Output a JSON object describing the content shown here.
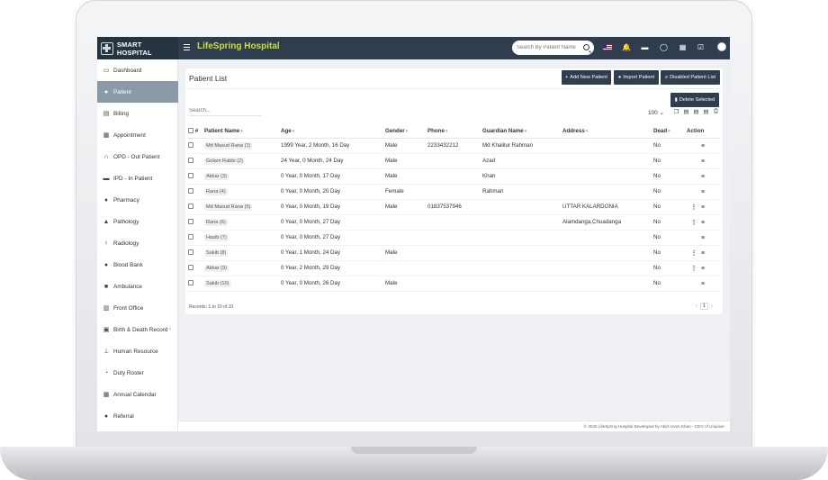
{
  "app": {
    "brand": "SMART HOSPITAL",
    "hospital_name": "LifeSpring Hospital",
    "search_placeholder": "Search By Patient Name"
  },
  "icons": {
    "flag": "us-flag-icon",
    "bell": "bell-icon",
    "bed": "bed-icon",
    "whatsapp": "whatsapp-icon",
    "calendar": "calendar-icon",
    "tasks": "checkbox-icon",
    "user": "user-avatar"
  },
  "colors": {
    "topbar": "#2f3d4e",
    "accent_text": "#c6e03c",
    "active_sidebar": "#8a9aa6"
  },
  "sidebar": {
    "items": [
      {
        "label": "Dashboard",
        "icon": "desktop-icon",
        "active": false
      },
      {
        "label": "Patient",
        "icon": "user-icon",
        "active": true
      },
      {
        "label": "Billing",
        "icon": "file-icon",
        "active": false
      },
      {
        "label": "Appointment",
        "icon": "calendar-icon",
        "active": false
      },
      {
        "label": "OPD - Out Patient",
        "icon": "stethoscope-icon",
        "active": false
      },
      {
        "label": "IPD - In Patient",
        "icon": "bed-icon",
        "active": false
      },
      {
        "label": "Pharmacy",
        "icon": "mortar-icon",
        "active": false
      },
      {
        "label": "Pathology",
        "icon": "flask-icon",
        "active": false
      },
      {
        "label": "Radiology",
        "icon": "microscope-icon",
        "active": false
      },
      {
        "label": "Blood Bank",
        "icon": "tint-icon",
        "active": false
      },
      {
        "label": "Ambulance",
        "icon": "ambulance-icon",
        "active": false
      },
      {
        "label": "Front Office",
        "icon": "building-icon",
        "active": false
      },
      {
        "label": "Birth & Death Record",
        "icon": "certificate-icon",
        "active": false,
        "has_submenu": true
      },
      {
        "label": "Human Resource",
        "icon": "sitemap-icon",
        "active": false
      },
      {
        "label": "Duty Roster",
        "icon": "clock-icon",
        "active": false
      },
      {
        "label": "Annual Calendar",
        "icon": "calendar-icon",
        "active": false
      },
      {
        "label": "Referral",
        "icon": "users-icon",
        "active": false
      }
    ]
  },
  "panel": {
    "title": "Patient List",
    "buttons": {
      "add": "Add New Patient",
      "import": "Import Patient",
      "disabled": "Disabled Patient List",
      "delete": "Delete Selected"
    },
    "search_placeholder": "Search...",
    "per_page": "100"
  },
  "table": {
    "headers": [
      "#",
      "Patient Name",
      "Age",
      "Gender",
      "Phone",
      "Guardian Name",
      "Address",
      "Dead",
      "Action"
    ],
    "rows": [
      {
        "name": "Md Masud Rana (1)",
        "age": "1999 Year, 2 Month, 16 Day",
        "gender": "Male",
        "phone": "2233432212",
        "guardian": "Md Khalilur Rahman",
        "address": "",
        "dead": "No",
        "kebab": false
      },
      {
        "name": "Golam Rabbi (2)",
        "age": "24 Year, 0 Month, 24 Day",
        "gender": "Male",
        "phone": "",
        "guardian": "Azad",
        "address": "",
        "dead": "No",
        "kebab": false
      },
      {
        "name": "Akbar (3)",
        "age": "0 Year, 0 Month, 17 Day",
        "gender": "Male",
        "phone": "",
        "guardian": "Khan",
        "address": "",
        "dead": "No",
        "kebab": false
      },
      {
        "name": "Rana (4)",
        "age": "0 Year, 0 Month, 20 Day",
        "gender": "Female",
        "phone": "",
        "guardian": "Rahman",
        "address": "",
        "dead": "No",
        "kebab": false
      },
      {
        "name": "Md Masud Rana (5)",
        "age": "0 Year, 0 Month, 19 Day",
        "gender": "Male",
        "phone": "01837537946",
        "guardian": "",
        "address": "UTTAR KALARDONIA",
        "dead": "No",
        "kebab": true
      },
      {
        "name": "Rana (6)",
        "age": "0 Year, 0 Month, 27 Day",
        "gender": "",
        "phone": "",
        "guardian": "",
        "address": "Alamdanga,Chuadanga",
        "dead": "No",
        "kebab": true
      },
      {
        "name": "Hasib (7)",
        "age": "0 Year, 0 Month, 27 Day",
        "gender": "",
        "phone": "",
        "guardian": "",
        "address": "",
        "dead": "No",
        "kebab": false
      },
      {
        "name": "Sakib (8)",
        "age": "0 Year, 1 Month, 24 Day",
        "gender": "Male",
        "phone": "",
        "guardian": "",
        "address": "",
        "dead": "No",
        "kebab": true
      },
      {
        "name": "Akbar (9)",
        "age": "0 Year, 2 Month, 29 Day",
        "gender": "",
        "phone": "",
        "guardian": "",
        "address": "",
        "dead": "No",
        "kebab": true
      },
      {
        "name": "Sakib (10)",
        "age": "0 Year, 0 Month, 26 Day",
        "gender": "Male",
        "phone": "",
        "guardian": "",
        "address": "",
        "dead": "No",
        "kebab": false
      }
    ]
  },
  "records": "Records: 1 to 10 of 10",
  "pagination": {
    "prev": "‹",
    "page": "1",
    "next": "›"
  },
  "footer": "© 2026 LifeSpring Hospital Developed by Abid Azam Khan - CEO of Unipixer"
}
